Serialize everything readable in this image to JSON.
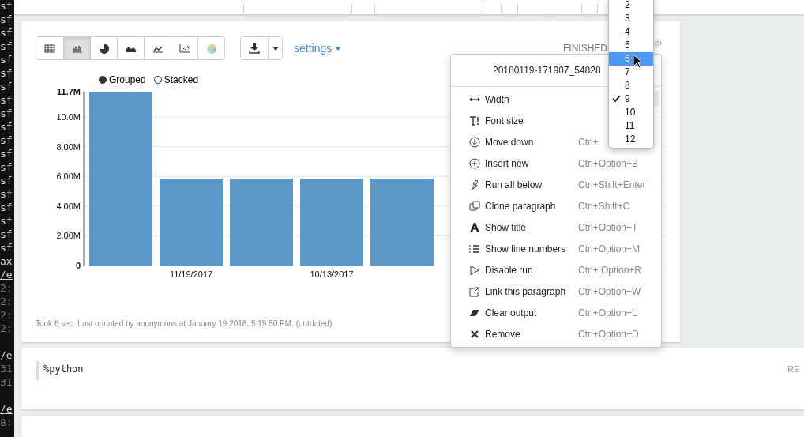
{
  "terminal": {
    "lines": [
      {
        "text": "sf",
        "kind": "plain"
      },
      {
        "text": "sf",
        "kind": "plain"
      },
      {
        "text": "sf",
        "kind": "plain"
      },
      {
        "text": "sf",
        "kind": "plain"
      },
      {
        "text": "sf",
        "kind": "plain"
      },
      {
        "text": "sf",
        "kind": "plain"
      },
      {
        "text": "sf",
        "kind": "plain"
      },
      {
        "text": "sf",
        "kind": "plain"
      },
      {
        "text": "sf",
        "kind": "plain"
      },
      {
        "text": "sf",
        "kind": "plain"
      },
      {
        "text": "sf",
        "kind": "plain"
      },
      {
        "text": "sf",
        "kind": "plain"
      },
      {
        "text": "sf",
        "kind": "plain"
      },
      {
        "text": "sf",
        "kind": "plain"
      },
      {
        "text": "sf",
        "kind": "plain"
      },
      {
        "text": "sf",
        "kind": "plain"
      },
      {
        "text": "sf",
        "kind": "plain"
      },
      {
        "text": "sf",
        "kind": "plain"
      },
      {
        "text": "sf",
        "kind": "plain"
      },
      {
        "text": "ax",
        "kind": "plain"
      },
      {
        "text": "/e",
        "kind": "link"
      },
      {
        "text": "2:",
        "kind": "dim"
      },
      {
        "text": "2:",
        "kind": "dim"
      },
      {
        "text": "2:",
        "kind": "dim"
      },
      {
        "text": "2:",
        "kind": "dim"
      },
      {
        "kind": "blank"
      },
      {
        "text": "/e",
        "kind": "link"
      },
      {
        "text": "31",
        "kind": "dim"
      },
      {
        "text": "31",
        "kind": "dim"
      },
      {
        "kind": "blank"
      },
      {
        "text": "/e",
        "kind": "link"
      },
      {
        "text": "8:",
        "kind": "dim"
      }
    ]
  },
  "paragraph": {
    "view_buttons": [
      {
        "kind": "table",
        "selected": false
      },
      {
        "kind": "bar",
        "selected": true
      },
      {
        "kind": "pie",
        "selected": false
      },
      {
        "kind": "area",
        "selected": false
      },
      {
        "kind": "line",
        "selected": false
      },
      {
        "kind": "scatter",
        "selected": false
      },
      {
        "kind": "colorpie",
        "selected": false
      }
    ],
    "settings_link": "settings",
    "status": "FINISHED",
    "legend": [
      {
        "label": "Grouped",
        "selected": true
      },
      {
        "label": "Stacked",
        "selected": false
      }
    ],
    "chart_data": {
      "type": "bar",
      "categories": [
        null,
        "11/19/2017",
        null,
        "10/13/2017",
        null,
        null
      ],
      "values": [
        11700000,
        5850000,
        5850000,
        5830000,
        5850000,
        null
      ],
      "grid": true,
      "ylim": [
        0,
        11700000
      ],
      "yticks": [
        {
          "value": 0,
          "label": "0"
        },
        {
          "value": 2000000,
          "label": "2.00M"
        },
        {
          "value": 4000000,
          "label": "4.00M"
        },
        {
          "value": 6000000,
          "label": "6.00M"
        },
        {
          "value": 8000000,
          "label": "8.00M"
        },
        {
          "value": 10000000,
          "label": "10.0M"
        },
        {
          "value": 11700000,
          "label": "11.7M"
        }
      ]
    },
    "footer": "Took 6 sec. Last updated by anonymous at January 19 2018, 5:19:50 PM. (outdated)"
  },
  "menu": {
    "title": "20180119-171907_54828",
    "items": [
      {
        "kind": "width",
        "label": "Width"
      },
      {
        "kind": "fontsize",
        "label": "Font size"
      },
      {
        "kind": "movedown",
        "label": "Move down",
        "shortcut": "Ctrl+"
      },
      {
        "kind": "insert",
        "label": "Insert new",
        "shortcut": "Ctrl+Option+B"
      },
      {
        "kind": "runbelow",
        "label": "Run all below",
        "shortcut": "Ctrl+Shift+Enter"
      },
      {
        "kind": "clone",
        "label": "Clone paragraph",
        "shortcut": "Ctrl+Shift+C"
      },
      {
        "kind": "title",
        "label": "Show title",
        "shortcut": "Ctrl+Option+T"
      },
      {
        "kind": "linenumbers",
        "label": "Show line numbers",
        "shortcut": "Ctrl+Option+M"
      },
      {
        "kind": "disable",
        "label": "Disable run",
        "shortcut": "Ctrl+ Option+R"
      },
      {
        "kind": "link",
        "label": "Link this paragraph",
        "shortcut": "Ctrl+Option+W"
      },
      {
        "kind": "clear",
        "label": "Clear output",
        "shortcut": "Ctrl+Option+L"
      },
      {
        "kind": "remove",
        "label": "Remove",
        "shortcut": "Ctrl+Option+D"
      }
    ]
  },
  "width_options": [
    {
      "label": "2",
      "selected": false,
      "checked": false
    },
    {
      "label": "3",
      "selected": false,
      "checked": false
    },
    {
      "label": "4",
      "selected": false,
      "checked": false
    },
    {
      "label": "5",
      "selected": false,
      "checked": false
    },
    {
      "label": "6",
      "selected": true,
      "checked": false
    },
    {
      "label": "7",
      "selected": false,
      "checked": false
    },
    {
      "label": "8",
      "selected": false,
      "checked": false
    },
    {
      "label": "9",
      "selected": false,
      "checked": true
    },
    {
      "label": "10",
      "selected": false,
      "checked": false
    },
    {
      "label": "11",
      "selected": false,
      "checked": false
    },
    {
      "label": "12",
      "selected": false,
      "checked": false
    }
  ],
  "code_paragraphs": [
    {
      "code": "%python",
      "status": "RE"
    }
  ]
}
